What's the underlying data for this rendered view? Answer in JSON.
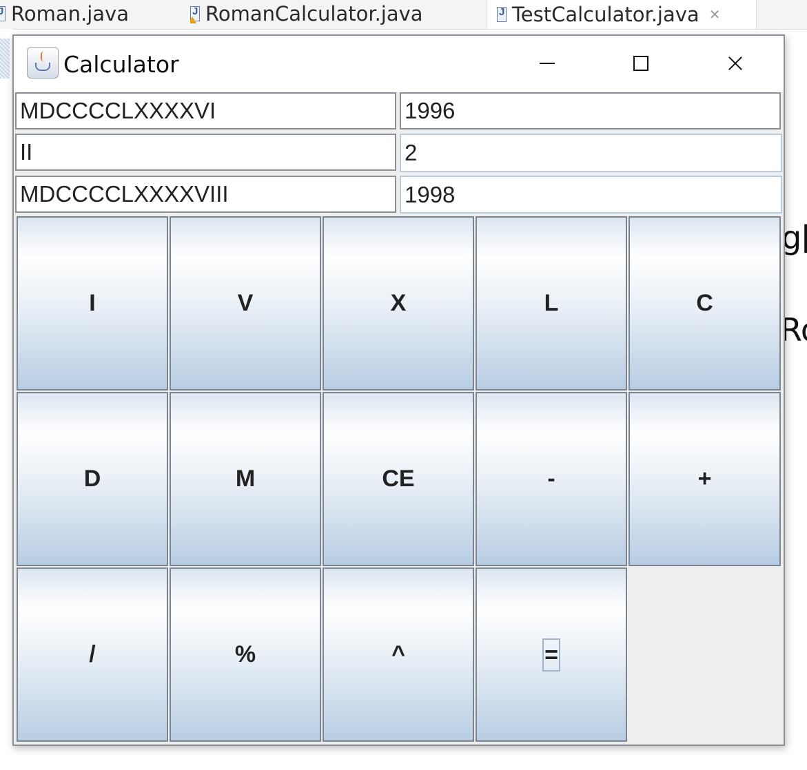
{
  "editor_tabs": [
    {
      "label": "Roman.java",
      "has_warning": false,
      "active": false
    },
    {
      "label": "RomanCalculator.java",
      "has_warning": true,
      "active": false
    },
    {
      "label": "TestCalculator.java",
      "has_warning": false,
      "active": true,
      "close_icon": "close-icon"
    }
  ],
  "background_code_fragments": [
    "g[",
    "Ro"
  ],
  "window": {
    "title": "Calculator",
    "icon": "java-cup-icon",
    "controls": {
      "minimize": "minimize-icon",
      "maximize": "maximize-icon",
      "close": "close-icon"
    }
  },
  "fields": [
    {
      "roman": "MDCCCCLXXXXVI",
      "decimal": "1996"
    },
    {
      "roman": "II",
      "decimal": "2"
    },
    {
      "roman": "MDCCCCLXXXXVIII",
      "decimal": "1998"
    }
  ],
  "buttons": [
    [
      "I",
      "V",
      "X",
      "L",
      "C"
    ],
    [
      "D",
      "M",
      "CE",
      "-",
      "+"
    ],
    [
      "/",
      "%",
      "^",
      "="
    ]
  ],
  "focused_button": "=",
  "colors": {
    "button_top": "#ffffff",
    "button_bottom": "#b8cde3",
    "border": "#7a8591",
    "window_background": "#eeeeee"
  }
}
